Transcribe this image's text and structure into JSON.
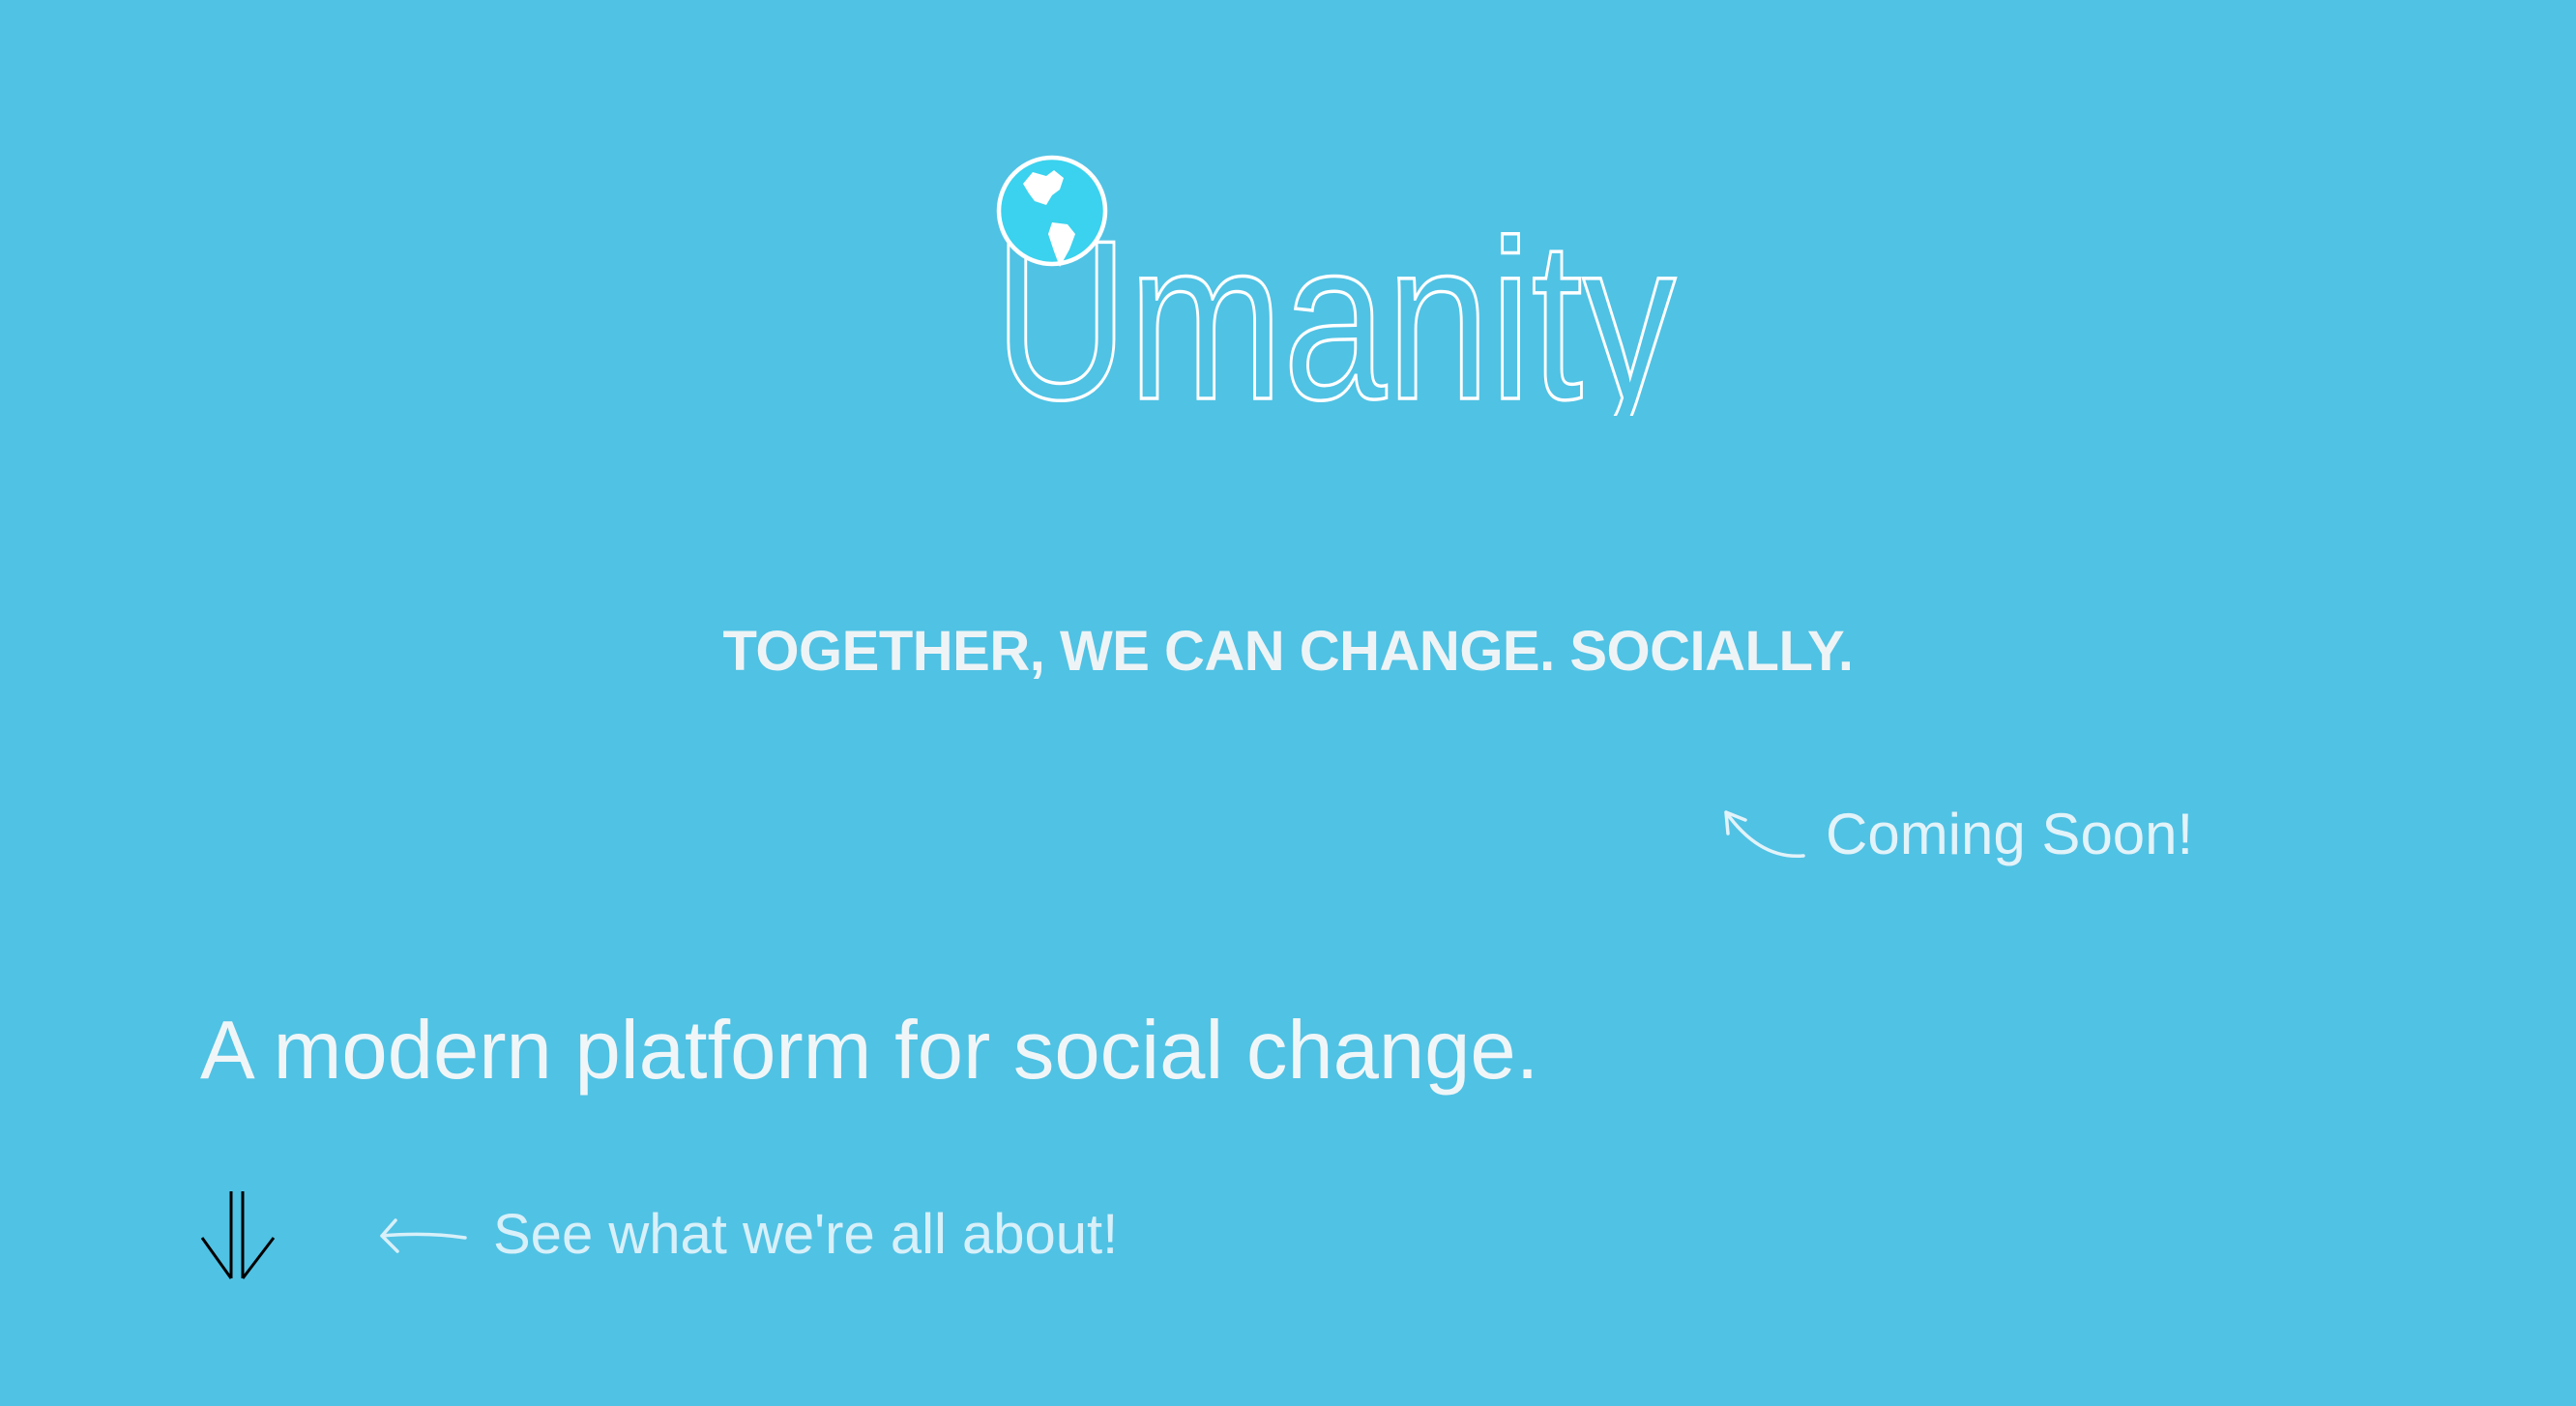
{
  "brand": {
    "name": "Umanity",
    "logo_text": "manity"
  },
  "tagline": "TOGETHER, WE CAN CHANGE. SOCIALLY.",
  "coming_soon": "Coming Soon!",
  "headline": "A modern platform for social change.",
  "scroll_cta": "See what we're all about!",
  "icons": {
    "globe": "globe-icon",
    "scroll": "double-down-arrow-icon",
    "pointer": "hand-drawn-arrow-icon"
  },
  "colors": {
    "background": "#50c2e4",
    "text": "#eef4f6",
    "arrow": "#000000"
  }
}
